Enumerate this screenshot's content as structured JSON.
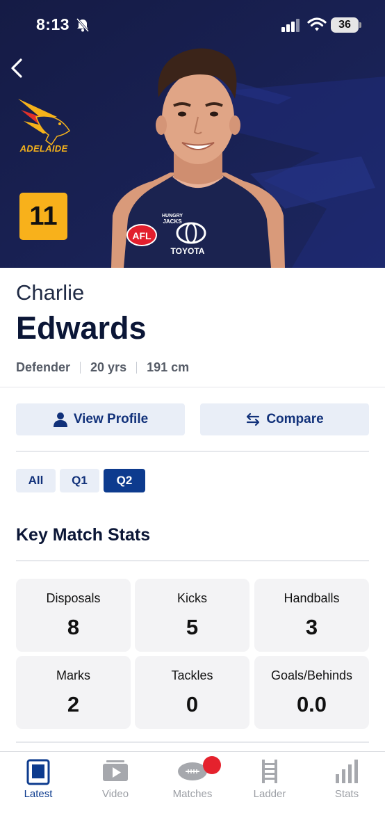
{
  "status_bar": {
    "time": "8:13",
    "battery": "36"
  },
  "hero": {
    "club_name": "ADELAIDE",
    "jersey_number": "11"
  },
  "player": {
    "first_name": "Charlie",
    "last_name": "Edwards",
    "position": "Defender",
    "age": "20 yrs",
    "height": "191 cm"
  },
  "actions": {
    "view_profile": "View Profile",
    "compare": "Compare"
  },
  "filters": [
    {
      "label": "All",
      "selected": false
    },
    {
      "label": "Q1",
      "selected": false
    },
    {
      "label": "Q2",
      "selected": true
    }
  ],
  "stats": {
    "title": "Key Match Stats",
    "items": [
      {
        "label": "Disposals",
        "value": "8"
      },
      {
        "label": "Kicks",
        "value": "5"
      },
      {
        "label": "Handballs",
        "value": "3"
      },
      {
        "label": "Marks",
        "value": "2"
      },
      {
        "label": "Tackles",
        "value": "0"
      },
      {
        "label": "Goals/Behinds",
        "value": "0.0"
      }
    ]
  },
  "tabs": [
    {
      "label": "Latest",
      "icon": "latest-icon",
      "active": true
    },
    {
      "label": "Video",
      "icon": "video-icon",
      "active": false
    },
    {
      "label": "Matches",
      "icon": "football-icon",
      "active": false
    },
    {
      "label": "Ladder",
      "icon": "ladder-icon",
      "active": false
    },
    {
      "label": "Stats",
      "icon": "bar-chart-icon",
      "active": false
    }
  ],
  "colors": {
    "hero_bg": "#141b44",
    "badge": "#f8b11b",
    "accent": "#0d3b8e",
    "button_bg": "#e9eef7",
    "notification": "#e5222d"
  }
}
